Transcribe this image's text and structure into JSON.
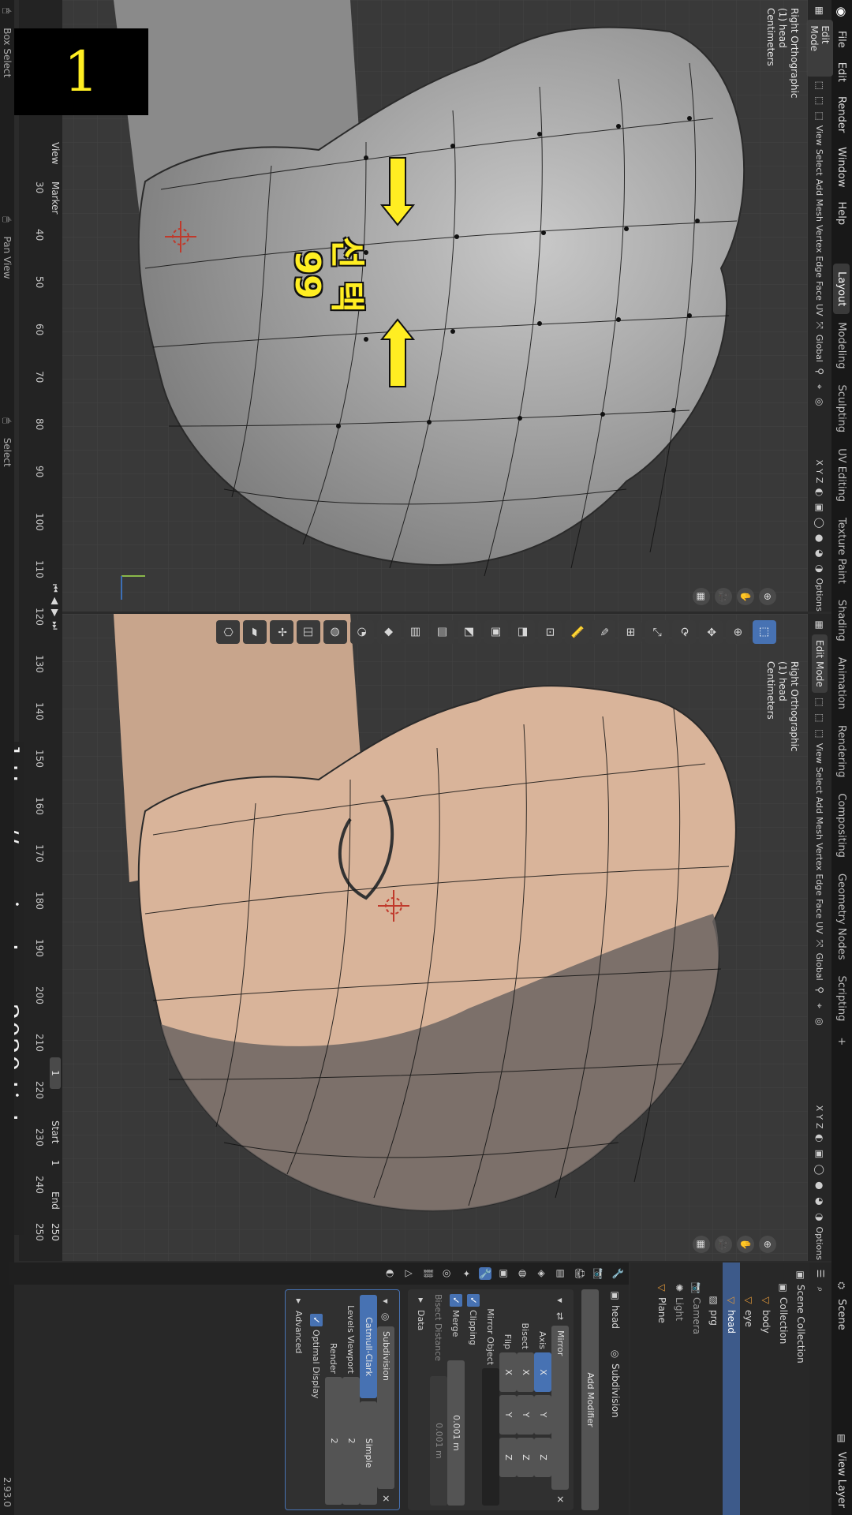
{
  "menu": {
    "items": [
      "File",
      "Edit",
      "Render",
      "Window",
      "Help"
    ],
    "workspaces": [
      "Layout",
      "Modeling",
      "Sculpting",
      "UV Editing",
      "Texture Paint",
      "Shading",
      "Animation",
      "Rendering",
      "Compositing",
      "Geometry Nodes",
      "Scripting"
    ],
    "plus": "+",
    "scene": "Scene",
    "view_layer": "View Layer"
  },
  "viewport_header": {
    "mode": "Edit Mode",
    "menus": [
      "View",
      "Select",
      "Add",
      "Mesh",
      "Vertex",
      "Edge",
      "Face",
      "UV"
    ],
    "orientation": "Global",
    "options": "Options",
    "axes": [
      "X",
      "Y",
      "Z"
    ]
  },
  "viewport_info": {
    "view": "Right Orthographic",
    "object": "(1) head",
    "units": "Centimeters"
  },
  "annotation": {
    "number": "1",
    "text_line1": "선 택",
    "text_line2": "99"
  },
  "timeline": {
    "menus": [
      "View",
      "Marker"
    ],
    "ticks": [
      "30",
      "40",
      "50",
      "60",
      "70",
      "80",
      "90",
      "100",
      "110",
      "120",
      "130",
      "140",
      "150",
      "160",
      "170",
      "180",
      "190",
      "200",
      "210",
      "220",
      "230",
      "240",
      "250"
    ],
    "current": "1",
    "start_label": "Start",
    "start": "1",
    "end_label": "End",
    "end": "250"
  },
  "watermark": "https://movingtoon2020.tistory.com",
  "status": {
    "box_select": "Box Select",
    "pan_view": "Pan View",
    "select": "Select",
    "version": "2.93.0"
  },
  "outliner": {
    "root": "Scene Collection",
    "collection": "Collection",
    "items": [
      "body",
      "eye",
      "head",
      "prg",
      "Camera",
      "Light",
      "Plane"
    ]
  },
  "properties": {
    "object": "head",
    "modifier_tab": "Subdivision",
    "add_modifier": "Add Modifier",
    "mirror": {
      "name": "Mirror",
      "axis_label": "Axis",
      "bisect_label": "Bisect",
      "flip_label": "Flip",
      "axes": [
        "X",
        "Y",
        "Z"
      ],
      "mirror_object": "Mirror Object",
      "clipping": "Clipping",
      "merge": "Merge",
      "merge_value": "0.001 m",
      "bisect_distance": "Bisect Distance",
      "bisect_value": "0.001 m",
      "data": "Data"
    },
    "subdivision": {
      "name": "Subdivision",
      "catmull": "Catmull-Clark",
      "simple": "Simple",
      "levels_viewport": "Levels Viewport",
      "levels_value": "2",
      "render": "Render",
      "render_value": "2",
      "optimal": "Optimal Display",
      "advanced": "Advanced"
    }
  },
  "colors": {
    "accent": "#4772b3",
    "annotation": "#ffee22",
    "skin": "#d9b49a"
  }
}
